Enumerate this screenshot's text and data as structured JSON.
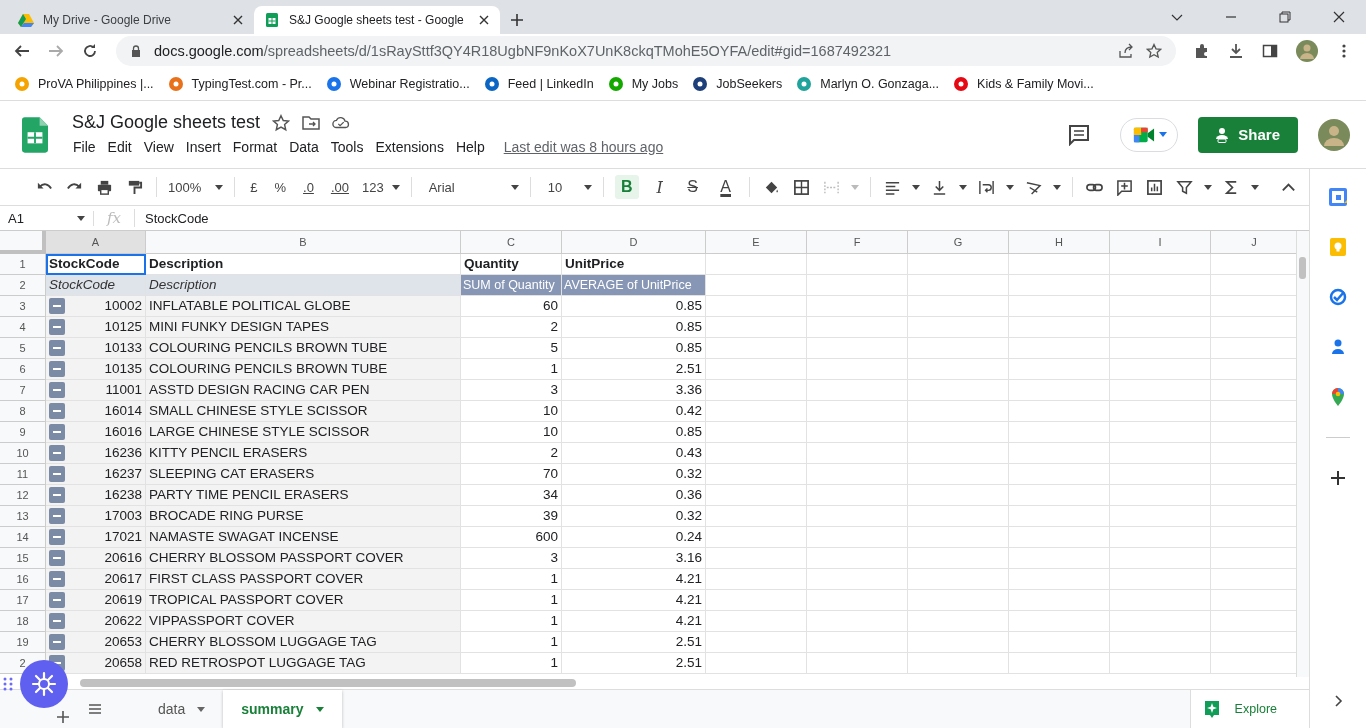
{
  "browser": {
    "tabs": [
      {
        "title": "My Drive - Google Drive",
        "selected": false
      },
      {
        "title": "S&J Google sheets test - Google",
        "selected": true
      }
    ],
    "url_host": "docs.google.com",
    "url_path": "/spreadsheets/d/1sRaySttf3QY4R18UgbNF9nKoX7UnK8ckqTMohE5OYFA/edit#gid=1687492321",
    "bookmarks": [
      "ProVA Philippines |...",
      "TypingTest.com - Pr...",
      "Webinar Registratio...",
      "Feed | LinkedIn",
      "My Jobs",
      "JobSeekers",
      "Marlyn O. Gonzaga...",
      "Kids & Family Movi..."
    ]
  },
  "document": {
    "title": "S&J Google sheets test",
    "menu": [
      "File",
      "Edit",
      "View",
      "Insert",
      "Format",
      "Data",
      "Tools",
      "Extensions",
      "Help"
    ],
    "last_edit": "Last edit was 8 hours ago",
    "share_label": "Share"
  },
  "toolbar": {
    "zoom": "100%",
    "currency": "£",
    "percent": "%",
    "decimal_less": ".0",
    "decimal_more": ".00",
    "number_format": "123",
    "font": "Arial",
    "font_size": "10",
    "format_buttons": [
      {
        "label": "B",
        "kind": "bold",
        "on": true
      },
      {
        "label": "I",
        "kind": "italic",
        "on": false
      },
      {
        "label": "S",
        "kind": "strike",
        "on": false
      },
      {
        "label": "A",
        "kind": "color",
        "on": false
      }
    ]
  },
  "formula_bar": {
    "name_box": "A1",
    "fx": "fx",
    "value": "StockCode"
  },
  "grid": {
    "columns": [
      "A",
      "B",
      "C",
      "D",
      "E",
      "F",
      "G",
      "H",
      "I",
      "J"
    ],
    "rows": [
      {
        "num": "1",
        "kind": "header",
        "cells": [
          {
            "text": "StockCode",
            "selected": true
          },
          {
            "text": "Description",
            "selected": false
          },
          {
            "text": "Quantity",
            "selected": false
          },
          {
            "text": "UnitPrice",
            "selected": false
          }
        ]
      },
      {
        "num": "2",
        "kind": "pivot_header",
        "cells": [
          "StockCode",
          "Description",
          "SUM of Quantity",
          "AVERAGE of UnitPrice"
        ]
      },
      {
        "num": "3",
        "kind": "item",
        "cells": [
          "10002",
          "INFLATABLE POLITICAL GLOBE",
          "60",
          "0.85"
        ]
      },
      {
        "num": "4",
        "kind": "item",
        "cells": [
          "10125",
          "MINI FUNKY DESIGN TAPES",
          "2",
          "0.85"
        ]
      },
      {
        "num": "5",
        "kind": "item",
        "cells": [
          "10133",
          "COLOURING PENCILS BROWN TUBE",
          "5",
          "0.85"
        ]
      },
      {
        "num": "6",
        "kind": "item",
        "cells": [
          "10135",
          "COLOURING PENCILS BROWN TUBE",
          "1",
          "2.51"
        ]
      },
      {
        "num": "7",
        "kind": "item",
        "cells": [
          "11001",
          "ASSTD DESIGN RACING CAR PEN",
          "3",
          "3.36"
        ]
      },
      {
        "num": "8",
        "kind": "item",
        "cells": [
          "16014",
          "SMALL CHINESE STYLE SCISSOR",
          "10",
          "0.42"
        ]
      },
      {
        "num": "9",
        "kind": "item",
        "cells": [
          "16016",
          "LARGE CHINESE STYLE SCISSOR",
          "10",
          "0.85"
        ]
      },
      {
        "num": "10",
        "kind": "item",
        "cells": [
          "16236",
          "KITTY PENCIL ERASERS",
          "2",
          "0.43"
        ]
      },
      {
        "num": "11",
        "kind": "item",
        "cells": [
          "16237",
          "SLEEPING CAT ERASERS",
          "70",
          "0.32"
        ]
      },
      {
        "num": "12",
        "kind": "item",
        "cells": [
          "16238",
          "PARTY TIME PENCIL ERASERS",
          "34",
          "0.36"
        ]
      },
      {
        "num": "13",
        "kind": "item",
        "cells": [
          "17003",
          "BROCADE RING PURSE",
          "39",
          "0.32"
        ]
      },
      {
        "num": "14",
        "kind": "item",
        "cells": [
          "17021",
          "NAMASTE SWAGAT INCENSE",
          "600",
          "0.24"
        ]
      },
      {
        "num": "15",
        "kind": "item",
        "cells": [
          "20616",
          "CHERRY BLOSSOM PASSPORT COVER",
          "3",
          "3.16"
        ]
      },
      {
        "num": "16",
        "kind": "item",
        "cells": [
          "20617",
          "FIRST CLASS PASSPORT COVER",
          "1",
          "4.21"
        ]
      },
      {
        "num": "17",
        "kind": "item",
        "cells": [
          "20619",
          "TROPICAL PASSPORT COVER",
          "1",
          "4.21"
        ]
      },
      {
        "num": "18",
        "kind": "item",
        "cells": [
          "20622",
          "VIPPASSPORT COVER",
          "1",
          "4.21"
        ]
      },
      {
        "num": "19",
        "kind": "item",
        "cells": [
          "20653",
          "CHERRY BLOSSOM LUGGAGE TAG",
          "1",
          "2.51"
        ]
      },
      {
        "num": "2",
        "kind": "item",
        "cells": [
          "20658",
          "RED RETROSPOT LUGGAGE TAG",
          "1",
          "2.51"
        ]
      }
    ]
  },
  "sheets": [
    {
      "name": "data",
      "selected": false
    },
    {
      "name": "summary",
      "selected": true
    }
  ],
  "explore_label": "Explore"
}
